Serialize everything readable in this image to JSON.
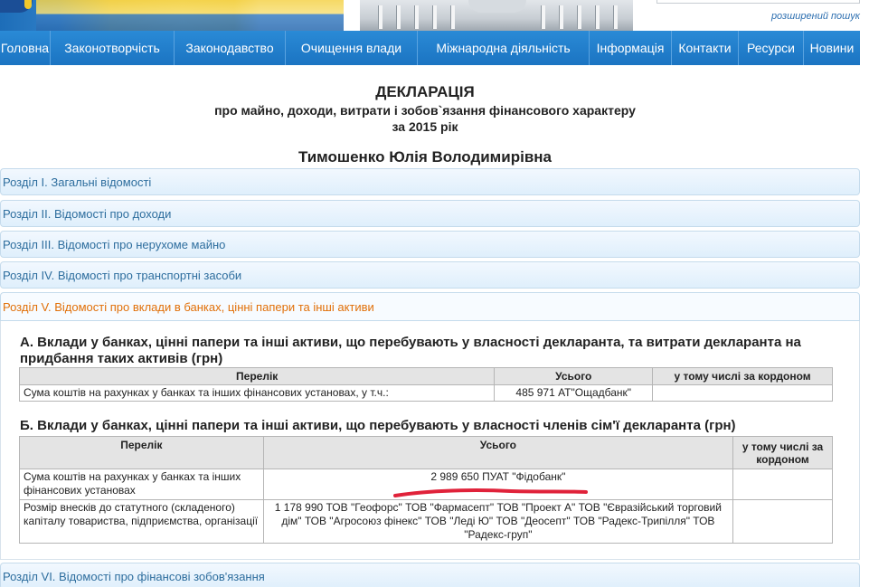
{
  "header": {
    "advanced_search_label": "розширений пошук"
  },
  "nav": {
    "items": [
      {
        "label": "Головна"
      },
      {
        "label": "Законотворчість"
      },
      {
        "label": "Законодавство"
      },
      {
        "label": "Очищення влади"
      },
      {
        "label": "Міжнародна діяльність"
      },
      {
        "label": "Інформація"
      },
      {
        "label": "Контакти"
      },
      {
        "label": "Ресурси"
      },
      {
        "label": "Новини"
      }
    ]
  },
  "declaration": {
    "title": "ДЕКЛАРАЦІЯ",
    "subtitle": "про майно, доходи, витрати і зобов`язання фінансового характеру",
    "year_line": "за 2015 рік",
    "person": "Тимошенко Юлія Володимирівна"
  },
  "sections": [
    {
      "label": "Розділ I. Загальні відомості"
    },
    {
      "label": "Розділ II. Відомості про доходи"
    },
    {
      "label": "Розділ III. Відомості про нерухоме майно"
    },
    {
      "label": "Розділ IV. Відомості про транспортні засоби"
    },
    {
      "label": "Розділ V. Відомості про вклади в банках, цінні папери та інші активи"
    },
    {
      "label": "Розділ VI. Відомості про фінансові зобов'язання"
    }
  ],
  "section5": {
    "part_a": {
      "title": "А. Вклади у банках, цінні папери та інші активи, що перебувають у власності декларанта, та витрати декларанта на придбання таких активів (грн)",
      "headers": [
        "Перелік",
        "Усього",
        "у тому числі за кордоном"
      ],
      "rows": [
        {
          "item": "Сума коштів на рахунках у банках та інших фінансових установах, у т.ч.:",
          "total": "485 971 АТ\"Ощадбанк\"",
          "abroad": ""
        }
      ]
    },
    "part_b": {
      "title": "Б. Вклади у банках, цінні папери та інші активи, що перебувають у власності членів сім'ї декларанта (грн)",
      "headers": [
        "Перелік",
        "Усього",
        "у тому числі за кордоном"
      ],
      "rows": [
        {
          "item": "Сума коштів на рахунках у банках та інших фінансових установах",
          "total": "2 989 650 ПУАТ \"Фідобанк\"",
          "abroad": ""
        },
        {
          "item": "Розмір внесків до статутного (складеного) капіталу товариства, підприємства, організації",
          "total": "1 178 990 ТОВ \"Геофорс\" ТОВ \"Фармасепт\" ТОВ \"Проект А\" ТОВ \"Євразійський торговий дім\" ТОВ \"Агросоюз фінекс\" ТОВ \"Леді Ю\" ТОВ \"Деосепт\" ТОВ \"Радекс-Трипілля\" ТОВ \"Радекс-груп\"",
          "abroad": ""
        }
      ]
    }
  },
  "colors": {
    "nav_blue": "#1b74c2",
    "section_link": "#2e6e9e",
    "section_active": "#e17009",
    "highlight_underline": "#e0223a"
  }
}
